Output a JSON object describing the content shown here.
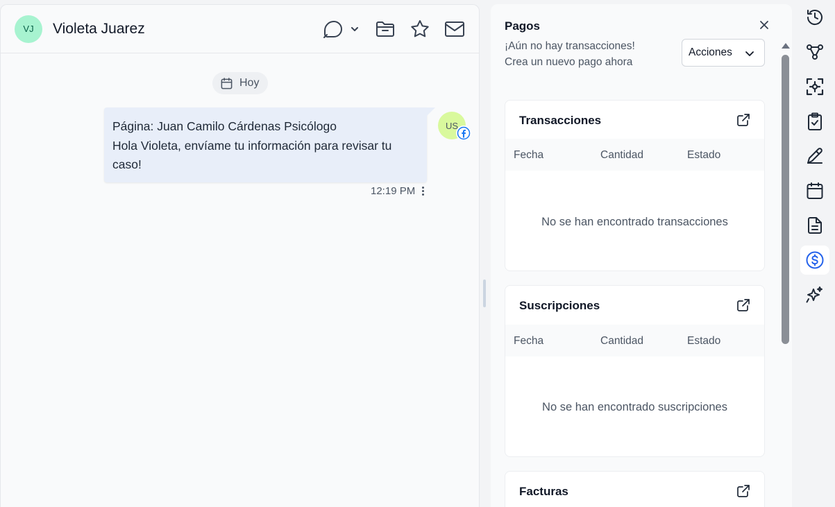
{
  "contact": {
    "initials": "VJ",
    "name": "Violeta Juarez"
  },
  "conversation": {
    "date_label": "Hoy",
    "message": {
      "line1": "Página: Juan Camilo Cárdenas Psicólogo",
      "line2": "Hola Violeta, envíame tu información para revisar tu caso!",
      "time": "12:19 PM",
      "sender_initials": "US",
      "channel_icon": "facebook-icon"
    }
  },
  "payments": {
    "title": "Pagos",
    "subtitle": "¡Aún no hay transacciones! Crea un nuevo pago ahora",
    "actions_label": "Acciones",
    "transactions": {
      "title": "Transacciones",
      "columns": [
        "Fecha",
        "Cantidad",
        "Estado"
      ],
      "empty": "No se han encontrado transacciones"
    },
    "subscriptions": {
      "title": "Suscripciones",
      "columns": [
        "Fecha",
        "Cantidad",
        "Estado"
      ],
      "empty": "No se han encontrado suscripciones"
    },
    "invoices": {
      "title": "Facturas"
    }
  },
  "rail": {
    "icons": [
      "history-icon",
      "workflow-icon",
      "ai-scan-icon",
      "clipboard-check-icon",
      "pen-icon",
      "calendar-icon",
      "document-icon",
      "dollar-icon",
      "sparkles-icon"
    ],
    "active": "dollar-icon"
  },
  "colors": {
    "accent": "#2563eb",
    "contact_avatar_bg": "#a7f3d0",
    "sender_avatar_bg": "#d9f99d",
    "bubble_bg": "#e8eef9"
  }
}
